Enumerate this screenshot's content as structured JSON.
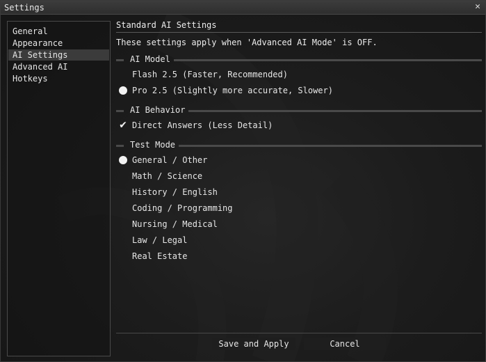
{
  "window": {
    "title": "Settings",
    "close_glyph": "✕"
  },
  "sidebar": {
    "items": [
      {
        "label": "General",
        "active": false
      },
      {
        "label": "Appearance",
        "active": false
      },
      {
        "label": "AI Settings",
        "active": true
      },
      {
        "label": "Advanced AI",
        "active": false
      },
      {
        "label": "Hotkeys",
        "active": false
      }
    ]
  },
  "main": {
    "title": "Standard AI Settings",
    "description": "These settings apply when 'Advanced AI Mode' is OFF.",
    "groups": {
      "ai_model": {
        "label": "AI Model",
        "options": [
          {
            "label": "Flash 2.5 (Faster, Recommended)",
            "selected": false
          },
          {
            "label": "Pro 2.5 (Slightly more accurate, Slower)",
            "selected": true
          }
        ]
      },
      "ai_behavior": {
        "label": "AI Behavior",
        "options": [
          {
            "label": "Direct Answers (Less Detail)",
            "checked": true
          }
        ]
      },
      "test_mode": {
        "label": "Test Mode",
        "options": [
          {
            "label": "General / Other",
            "selected": true
          },
          {
            "label": "Math / Science",
            "selected": false
          },
          {
            "label": "History / English",
            "selected": false
          },
          {
            "label": "Coding / Programming",
            "selected": false
          },
          {
            "label": "Nursing / Medical",
            "selected": false
          },
          {
            "label": "Law / Legal",
            "selected": false
          },
          {
            "label": "Real Estate",
            "selected": false
          }
        ]
      }
    }
  },
  "footer": {
    "save_label": "Save and Apply",
    "cancel_label": "Cancel"
  }
}
